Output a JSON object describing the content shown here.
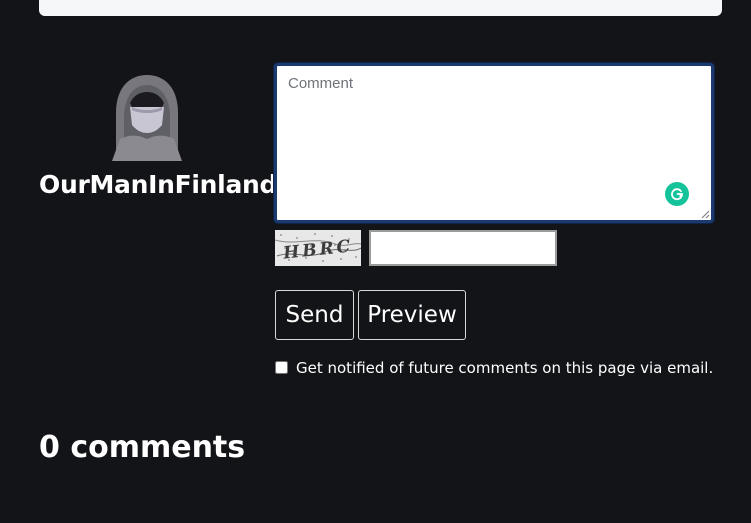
{
  "comment_form": {
    "user": {
      "avatar_icon": "hooded-figure-avatar-icon",
      "username": "OurManInFinland"
    },
    "comment": {
      "value": "",
      "placeholder": "Comment"
    },
    "grammarly_icon": "grammarly-icon",
    "captcha": {
      "image_text": "HBRC",
      "input_value": ""
    },
    "buttons": {
      "send": "Send",
      "preview": "Preview"
    },
    "notify": {
      "checked": false,
      "label": "Get notified of future comments on this page via email."
    }
  },
  "comments": {
    "count_heading": "0 comments"
  },
  "colors": {
    "background": "#131418",
    "focus_border": "#1b3a70",
    "grammarly": "#15c39a"
  }
}
